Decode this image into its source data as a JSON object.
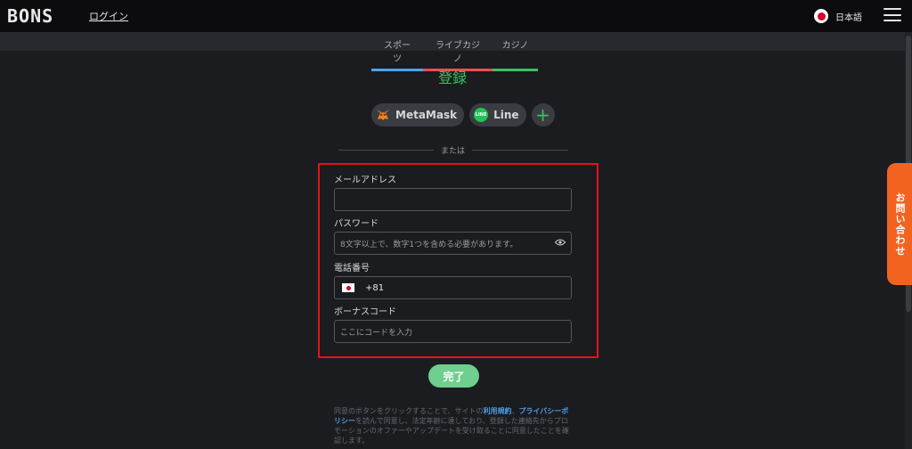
{
  "header": {
    "logo": "BONS",
    "login_label": "ログイン",
    "language": "日本語"
  },
  "nav": {
    "tabs": [
      {
        "label": "スポーツ",
        "color": "#49a4f1"
      },
      {
        "label": "ライブカジノ",
        "color": "#f04f4f"
      },
      {
        "label": "カジノ",
        "color": "#3bc35b"
      }
    ]
  },
  "register": {
    "title": "登録",
    "social": {
      "metamask": "MetaMask",
      "line": "Line",
      "line_badge": "LINE",
      "more": "+"
    },
    "divider": "または",
    "fields": {
      "email_label": "メールアドレス",
      "email_value": "",
      "password_label": "パスワード",
      "password_placeholder": "8文字以上で、数字1つを含める必要があります。",
      "phone_label": "電話番号",
      "phone_code": "+81",
      "bonus_label": "ボーナスコード",
      "bonus_placeholder": "ここにコードを入力"
    },
    "submit_label": "完了",
    "terms": {
      "prefix": "同意のボタンをクリックすることで、サイトの",
      "terms_link": "利用規約",
      "privacy_link": "プライバシーポリシー",
      "suffix": "を読んで同意し、法定年齢に達しており、登録した連絡先からプロモーションのオファーやアップデートを受け取ることに同意したことを確認します。"
    }
  },
  "contact_tab": "お問い合わせ",
  "colors": {
    "accent_green": "#36c35e",
    "highlight_red": "#e0141c",
    "contact_orange": "#f26322"
  }
}
